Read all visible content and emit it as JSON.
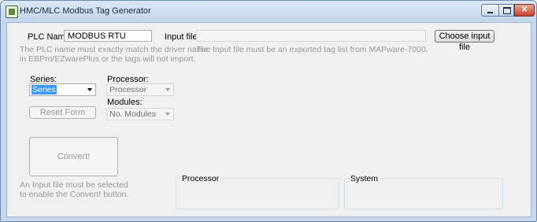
{
  "window": {
    "title": "HMC/MLC Modbus Tag Generator",
    "icon": "app-icon",
    "controls": {
      "minimize": "minimize-icon",
      "maximize": "maximize-icon",
      "close": "close-icon"
    },
    "close_glyph": "✕"
  },
  "form": {
    "plc_name_label": "PLC Name:",
    "plc_name_value": "MODBUS RTU",
    "plc_name_hint_line1": "The PLC name must exactly match the driver name",
    "plc_name_hint_line2": "in EBPro/EZwarePlus or the tags will not import.",
    "input_file_label": "Input file:",
    "input_file_value": "",
    "input_file_hint": "The Input file must be an exported tag list from MAPware-7000.",
    "choose_input_button": "Choose input file",
    "series_label": "Series:",
    "series_value": "Series",
    "processor_label": "Processor:",
    "processor_value": "Processor",
    "modules_label": "Modules:",
    "modules_value": "No. Modules",
    "reset_button": "Reset Form",
    "convert_button": "Convert!",
    "convert_hint_line1": "An Input file must be selected",
    "convert_hint_line2": "to enable the Convert! button.",
    "processor_group_title": "Processor",
    "system_group_title": "System"
  },
  "colors": {
    "title_bar": "#c4d6ec",
    "client_bg": "#f0f0f0",
    "selection": "#3399ff",
    "hint_text": "#9a9a9a"
  }
}
